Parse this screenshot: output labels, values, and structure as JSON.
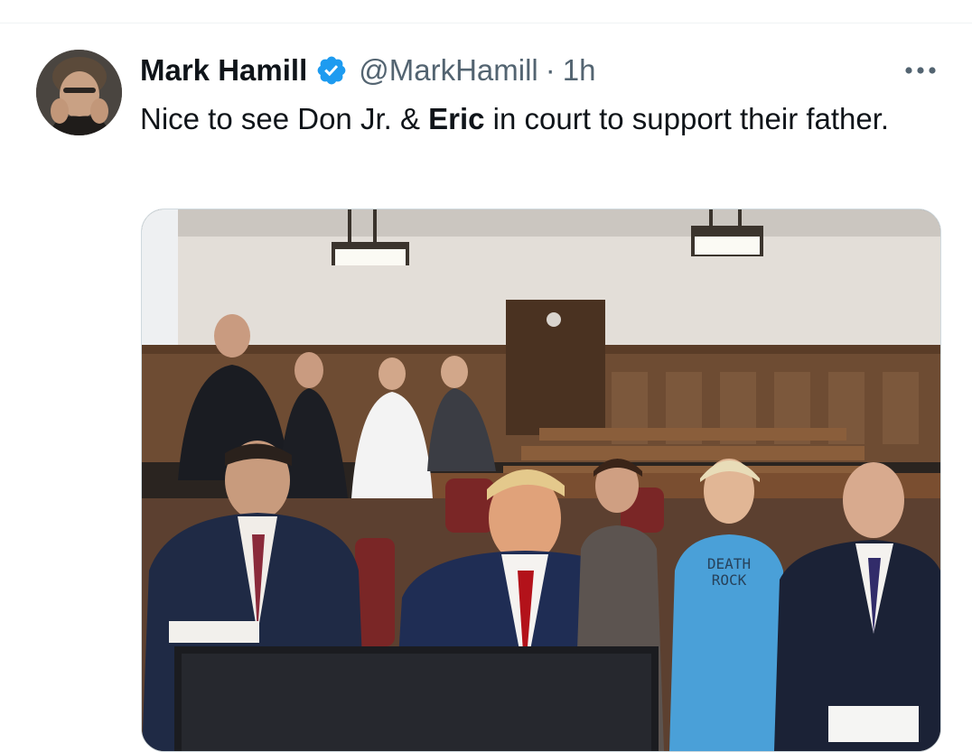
{
  "tweet": {
    "author": {
      "display_name": "Mark Hamill",
      "handle": "@MarkHamill",
      "verified": true,
      "avatar": "avatar"
    },
    "separator": "·",
    "time": "1h",
    "text": {
      "part1": "Nice to see Don Jr. & ",
      "bold": "Eric",
      "part2": " in court to support their father."
    },
    "media": {
      "shirt_text_line1": "DEATH",
      "shirt_text_line2": "ROCK"
    }
  },
  "icons": {
    "verified": "verified-badge-icon",
    "more": "more-options-icon"
  },
  "colors": {
    "text_primary": "#0f1419",
    "text_secondary": "#536471",
    "verified_blue": "#1d9bf0",
    "border": "#cfd9de"
  }
}
